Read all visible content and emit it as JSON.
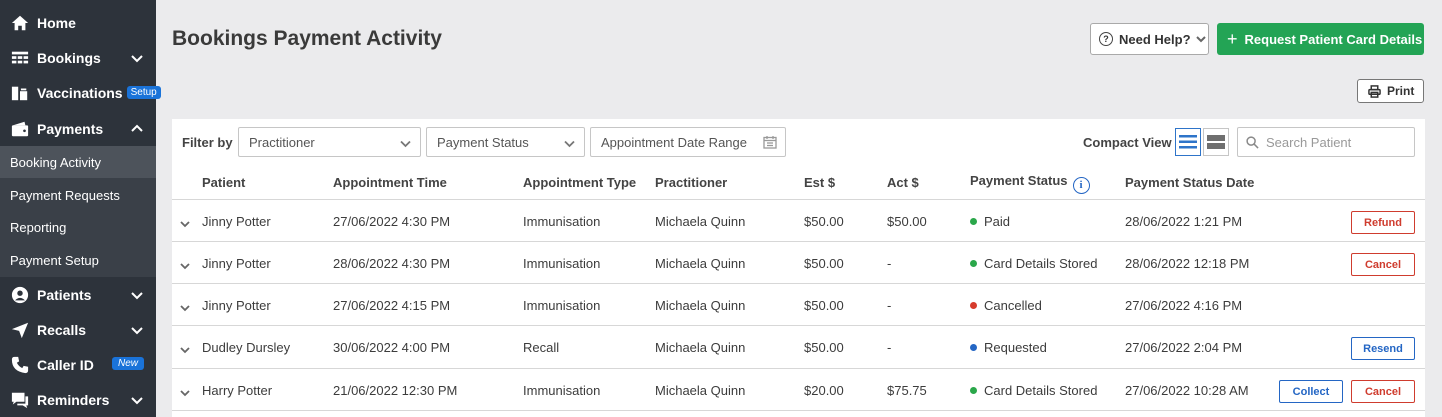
{
  "sidebar": {
    "items": [
      {
        "label": "Home",
        "icon": "home-icon"
      },
      {
        "label": "Bookings",
        "icon": "calendar-grid-icon"
      },
      {
        "label": "Vaccinations",
        "icon": "vaccine-icon",
        "badge": "Setup"
      },
      {
        "label": "Payments",
        "icon": "wallet-icon"
      },
      {
        "label": "Patients",
        "icon": "patient-icon"
      },
      {
        "label": "Recalls",
        "icon": "send-icon"
      },
      {
        "label": "Caller ID",
        "icon": "phone-icon",
        "badge": "New"
      },
      {
        "label": "Reminders",
        "icon": "chat-icon"
      }
    ],
    "payments_sub": [
      "Booking Activity",
      "Payment Requests",
      "Reporting",
      "Payment Setup"
    ]
  },
  "header": {
    "title": "Bookings Payment Activity",
    "help_label": "Need Help?",
    "request_label": "Request Patient Card Details",
    "print_label": "Print"
  },
  "filters": {
    "label": "Filter by",
    "practitioner": "Practitioner",
    "payment_status": "Payment Status",
    "date_range": "Appointment Date Range",
    "compact_view": "Compact View",
    "search_placeholder": "Search Patient"
  },
  "table": {
    "columns": [
      "Patient",
      "Appointment Time",
      "Appointment Type",
      "Practitioner",
      "Est $",
      "Act $",
      "Payment Status",
      "Payment Status Date"
    ],
    "rows": [
      {
        "patient": "Jinny Potter",
        "time": "27/06/2022 4:30 PM",
        "type": "Immunisation",
        "practitioner": "Michaela Quinn",
        "est": "$50.00",
        "act": "$50.00",
        "status": "Paid",
        "status_color": "#2aa74a",
        "date": "28/06/2022 1:21 PM",
        "actions": [
          "Refund"
        ]
      },
      {
        "patient": "Jinny Potter",
        "time": "28/06/2022 4:30 PM",
        "type": "Immunisation",
        "practitioner": "Michaela Quinn",
        "est": "$50.00",
        "act": "-",
        "status": "Card Details Stored",
        "status_color": "#2aa74a",
        "date": "28/06/2022 12:18 PM",
        "actions": [
          "Cancel"
        ]
      },
      {
        "patient": "Jinny Potter",
        "time": "27/06/2022 4:15 PM",
        "type": "Immunisation",
        "practitioner": "Michaela Quinn",
        "est": "$50.00",
        "act": "-",
        "status": "Cancelled",
        "status_color": "#d63b2c",
        "date": "27/06/2022 4:16 PM",
        "actions": []
      },
      {
        "patient": "Dudley Dursley",
        "time": "30/06/2022 4:00 PM",
        "type": "Recall",
        "practitioner": "Michaela Quinn",
        "est": "$50.00",
        "act": "-",
        "status": "Requested",
        "status_color": "#2466c4",
        "date": "27/06/2022 2:04 PM",
        "actions": [
          "Resend"
        ]
      },
      {
        "patient": "Harry Potter",
        "time": "21/06/2022 12:30 PM",
        "type": "Immunisation",
        "practitioner": "Michaela Quinn",
        "est": "$20.00",
        "act": "$75.75",
        "status": "Card Details Stored",
        "status_color": "#2aa74a",
        "date": "27/06/2022 10:28 AM",
        "actions": [
          "Collect",
          "Cancel"
        ]
      }
    ]
  },
  "colors": {
    "sidebar_bg": "#2d333b",
    "accent_green": "#23a455",
    "accent_blue": "#2466c4",
    "danger_red": "#cf3c2e"
  }
}
